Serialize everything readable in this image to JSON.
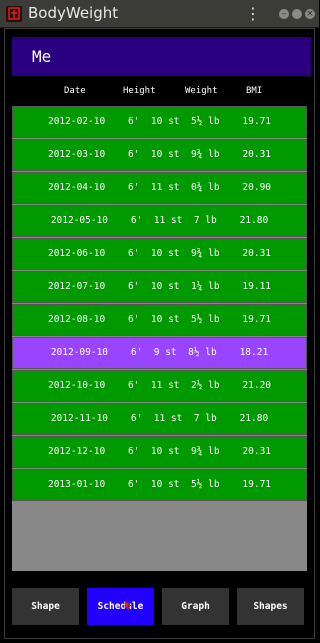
{
  "window": {
    "title": "BodyWeight",
    "menu_icon": "kebab-menu-icon",
    "controls": [
      "minimize-icon",
      "maximize-icon",
      "close-icon"
    ]
  },
  "profile": {
    "name": "Me"
  },
  "columns": {
    "date": "Date",
    "height": "Height",
    "weight": "Weight",
    "bmi": "BMI"
  },
  "entries": [
    {
      "text": "2012-02-10    6'  10 st  5½ lb    19.71",
      "selected": false
    },
    {
      "text": "2012-03-10    6'  10 st  9¾ lb    20.31",
      "selected": false
    },
    {
      "text": "2012-04-10    6'  11 st  0¾ lb    20.90",
      "selected": false
    },
    {
      "text": "2012-05-10    6'  11 st  7 lb    21.80",
      "selected": false
    },
    {
      "text": "2012-06-10    6'  10 st  9¾ lb    20.31",
      "selected": false
    },
    {
      "text": "2012-07-10    6'  10 st  1¼ lb    19.11",
      "selected": false
    },
    {
      "text": "2012-08-10    6'  10 st  5½ lb    19.71",
      "selected": false
    },
    {
      "text": "2012-09-10    6'  9 st  8½ lb    18.21",
      "selected": true
    },
    {
      "text": "2012-10-10    6'  11 st  2½ lb    21.20",
      "selected": false
    },
    {
      "text": "2012-11-10    6'  11 st  7 lb    21.80",
      "selected": false
    },
    {
      "text": "2012-12-10    6'  10 st  9¾ lb    20.31",
      "selected": false
    },
    {
      "text": "2013-01-10    6'  10 st  5½ lb    19.71",
      "selected": false
    }
  ],
  "nav": {
    "shape": "Shape",
    "schedule": "Schedule",
    "graph": "Graph",
    "shapes": "Shapes",
    "active": "schedule"
  },
  "colors": {
    "row": "#009900",
    "selected_row": "#9944ff",
    "header": "#2a0080",
    "active_button": "#2200ff",
    "button": "#333333"
  }
}
